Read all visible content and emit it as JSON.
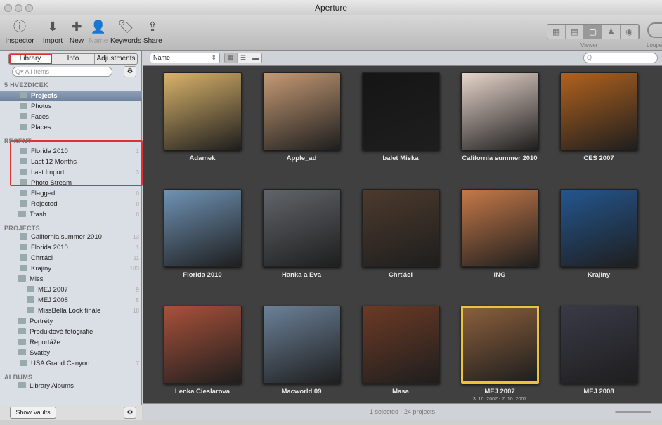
{
  "window": {
    "title": "Aperture"
  },
  "toolbar": {
    "left": [
      {
        "label": "Inspector",
        "icon": "info-icon"
      },
      {
        "label": "Import",
        "icon": "import-icon"
      },
      {
        "label": "New",
        "icon": "new-icon"
      },
      {
        "label": "Name",
        "icon": "name-icon"
      },
      {
        "label": "Keywords",
        "icon": "keywords-icon"
      },
      {
        "label": "Share",
        "icon": "share-icon"
      }
    ],
    "viewer_label": "Viewer",
    "loupe_label": "Loupe"
  },
  "sidebar": {
    "tabs": [
      "Library",
      "Info",
      "Adjustments"
    ],
    "search_placeholder": "All Items",
    "gear": "⚙",
    "sections": {
      "hvezdicek": "5 HVEZDICEK",
      "recent": "RECENT",
      "projects": "PROJECTS",
      "albums": "ALBUMS"
    },
    "favorites": [
      {
        "label": "Projects",
        "icon": "projects-icon"
      },
      {
        "label": "Photos",
        "icon": "photos-icon"
      },
      {
        "label": "Faces",
        "icon": "faces-icon"
      },
      {
        "label": "Places",
        "icon": "places-icon"
      }
    ],
    "recent": [
      {
        "label": "Florida 2010",
        "count": "1"
      },
      {
        "label": "Last 12 Months",
        "count": ""
      },
      {
        "label": "Last Import",
        "count": "3"
      },
      {
        "label": "Photo Stream",
        "count": ""
      },
      {
        "label": "Flagged",
        "count": "0"
      },
      {
        "label": "Rejected",
        "count": "0"
      },
      {
        "label": "Trash",
        "count": "0"
      }
    ],
    "projects": [
      {
        "label": "California summer 2010",
        "count": "13"
      },
      {
        "label": "Florida 2010",
        "count": "1"
      },
      {
        "label": "Chrťáci",
        "count": "11"
      },
      {
        "label": "Krajiny",
        "count": "183"
      },
      {
        "label": "Miss",
        "count": ""
      },
      {
        "label": "MEJ 2007",
        "count": "9"
      },
      {
        "label": "MEJ 2008",
        "count": "5"
      },
      {
        "label": "MissBella Look finále",
        "count": "18"
      },
      {
        "label": "Portréty",
        "count": ""
      },
      {
        "label": "Produktové fotografie",
        "count": ""
      },
      {
        "label": "Reportáže",
        "count": ""
      },
      {
        "label": "Svatby",
        "count": ""
      },
      {
        "label": "USA Grand Canyon",
        "count": "7"
      }
    ],
    "albums": [
      {
        "label": "Library Albums"
      }
    ],
    "show_vaults": "Show Vaults"
  },
  "main": {
    "sort": "Name",
    "status": "1 selected - 24 projects",
    "projects": [
      {
        "name": "Adamek",
        "color": "#d9b36a"
      },
      {
        "name": "Apple_ad",
        "color": "#c59a75"
      },
      {
        "name": "balet Miska",
        "color": "#151515"
      },
      {
        "name": "California summer 2010",
        "color": "#e7d5cb"
      },
      {
        "name": "CES 2007",
        "color": "#b1621e"
      },
      {
        "name": "Florida 2010",
        "color": "#6f93b5"
      },
      {
        "name": "Hanka a Eva",
        "color": "#61656a"
      },
      {
        "name": "Chrťáci",
        "color": "#4d3a2c"
      },
      {
        "name": "ING",
        "color": "#c67948"
      },
      {
        "name": "Krajiny",
        "color": "#24568f"
      },
      {
        "name": "Lenka Cieslarova",
        "color": "#a9513a"
      },
      {
        "name": "Macworld 09",
        "color": "#6b8198"
      },
      {
        "name": "Masa",
        "color": "#6c3a24"
      },
      {
        "name": "MEJ 2007",
        "color": "#8b5f3c",
        "sub": "3. 10. 2007 - 7. 10. 2007",
        "selected": true
      },
      {
        "name": "MEJ 2008",
        "color": "#3a3a48"
      }
    ]
  }
}
